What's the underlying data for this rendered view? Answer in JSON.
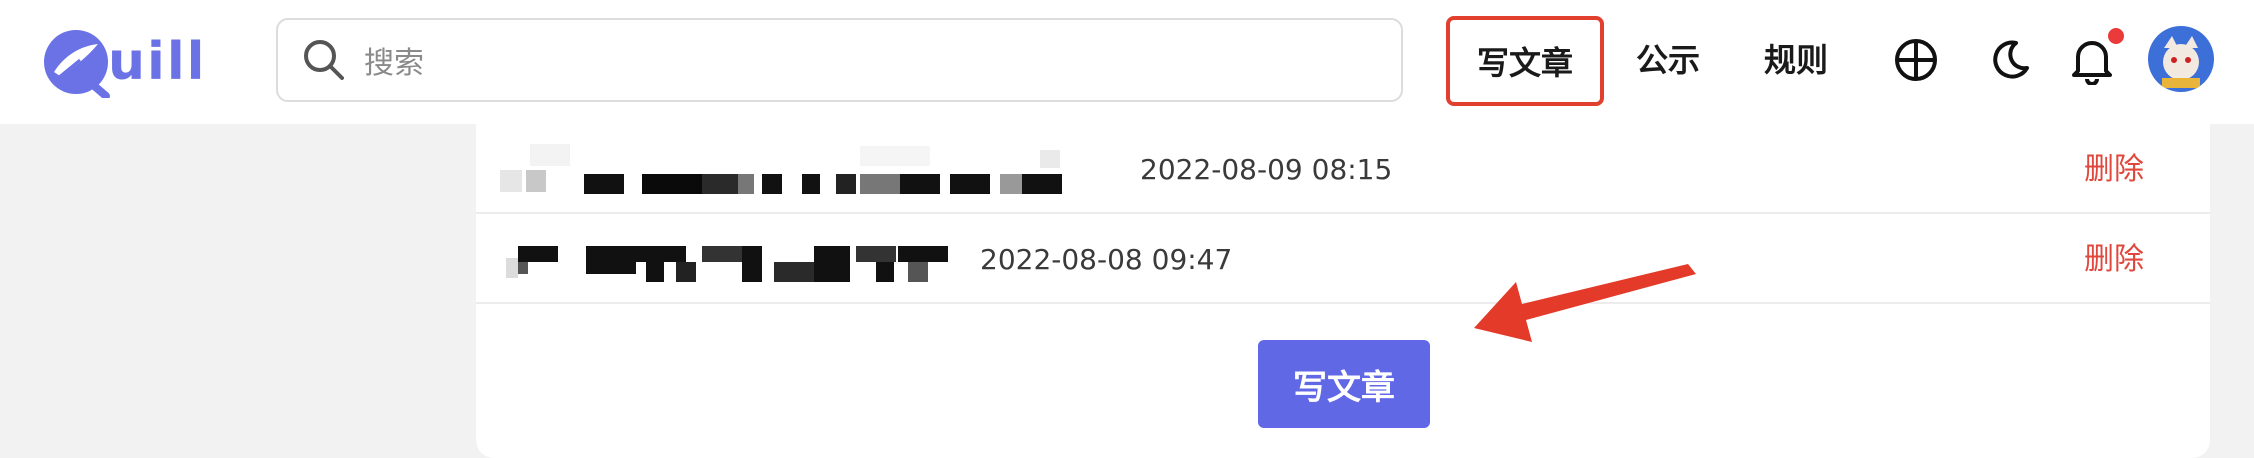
{
  "header": {
    "logo_text": "uill",
    "search_placeholder": "搜索",
    "nav": {
      "write_label": "写文章",
      "announcement_label": "公示",
      "rules_label": "规则"
    },
    "icons": [
      "search-icon",
      "globe-icon",
      "moon-icon",
      "bell-icon"
    ],
    "notification_dot": true
  },
  "articles": [
    {
      "date": "2022-08-09 08:15",
      "delete_label": "删除"
    },
    {
      "date": "2022-08-08 09:47",
      "delete_label": "删除"
    }
  ],
  "main": {
    "write_button_label": "写文章"
  },
  "colors": {
    "brand": "#6a72e6",
    "primary_button": "#6068e6",
    "highlight_border": "#e2402f",
    "delete_text": "#e0483d",
    "annotation_arrow": "#e43a2a",
    "badge": "#ea3a3a"
  }
}
